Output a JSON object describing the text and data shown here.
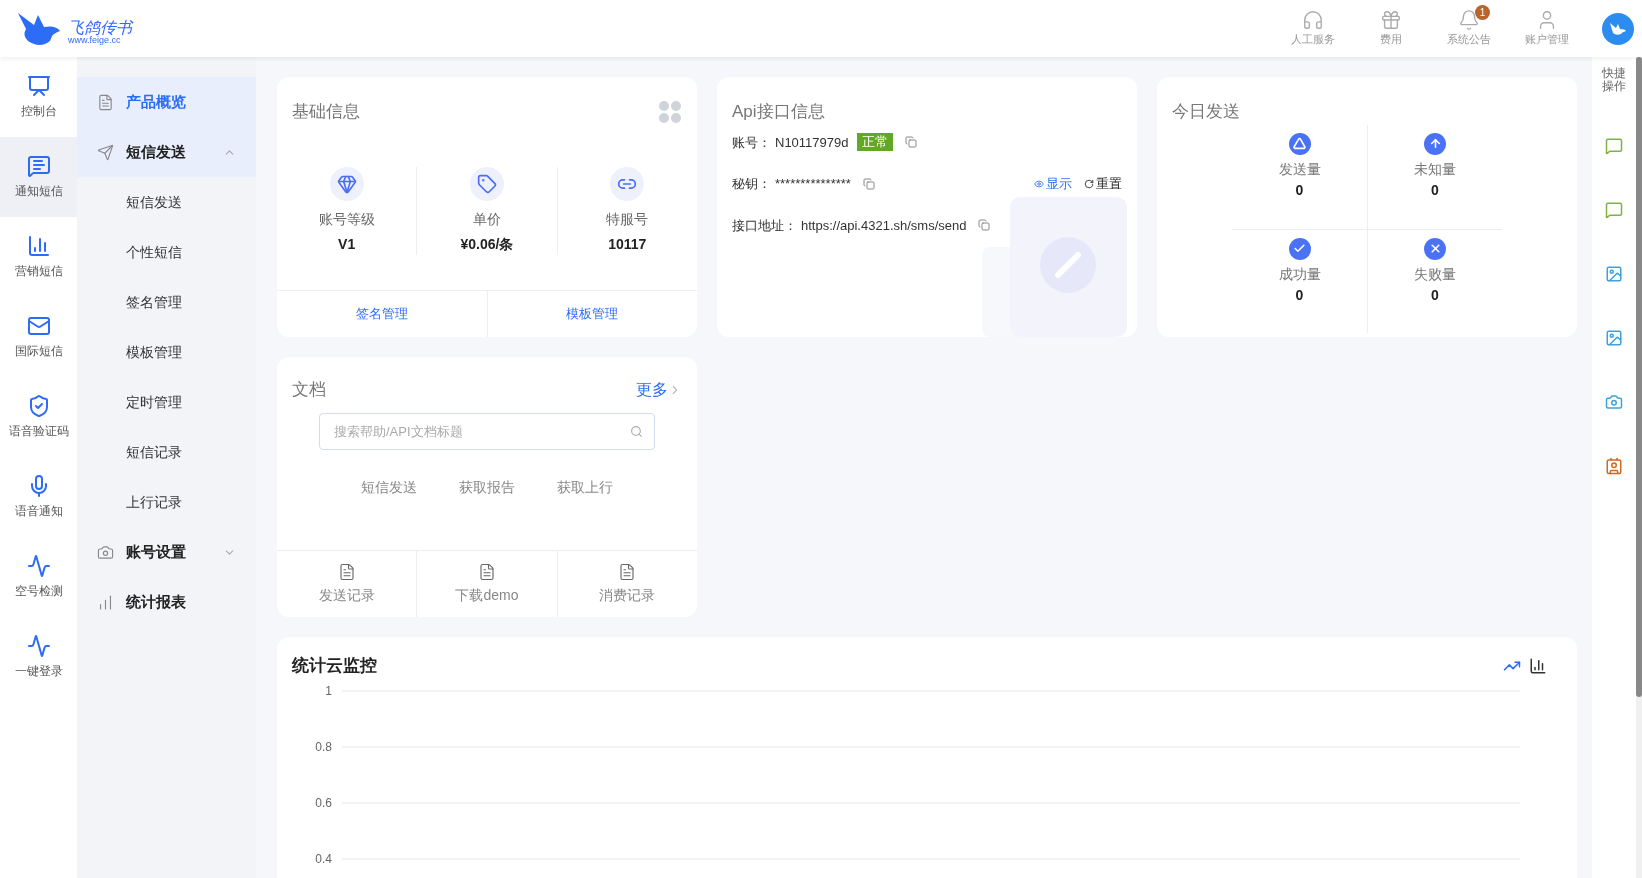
{
  "logo": {
    "name": "飞鸽传书",
    "url": "www.feige.cc"
  },
  "header_actions": [
    {
      "kind": "headset",
      "label": "人工服务"
    },
    {
      "kind": "gift",
      "label": "费用"
    },
    {
      "kind": "bell",
      "label": "系统公告",
      "badge": "1"
    },
    {
      "kind": "user",
      "label": "账户管理"
    }
  ],
  "rail": [
    {
      "kind": "monitor",
      "label": "控制台",
      "selected": false
    },
    {
      "kind": "message",
      "label": "通知短信",
      "selected": true
    },
    {
      "kind": "chart",
      "label": "营销短信",
      "selected": false
    },
    {
      "kind": "mail",
      "label": "国际短信",
      "selected": false
    },
    {
      "kind": "shield",
      "label": "语音验证码",
      "selected": false
    },
    {
      "kind": "mic",
      "label": "语音通知",
      "selected": false
    },
    {
      "kind": "activity",
      "label": "空号检测",
      "selected": false
    },
    {
      "kind": "activity",
      "label": "一键登录",
      "selected": false
    }
  ],
  "menu": [
    {
      "kind": "doc",
      "label": "产品概览",
      "selected": true
    },
    {
      "kind": "send",
      "label": "短信发送",
      "selected": false,
      "expanded": true,
      "children": [
        {
          "label": "短信发送",
          "selected": false
        },
        {
          "label": "个性短信",
          "selected": false
        },
        {
          "label": "签名管理",
          "selected": false
        },
        {
          "label": "模板管理",
          "selected": false
        },
        {
          "label": "定时管理",
          "selected": false
        },
        {
          "label": "短信记录",
          "selected": false
        },
        {
          "label": "上行记录",
          "selected": false
        }
      ]
    },
    {
      "kind": "settings",
      "label": "账号设置",
      "selected": false,
      "expanded": false
    },
    {
      "kind": "bars",
      "label": "统计报表",
      "selected": false
    }
  ],
  "basic_info": {
    "title": "基础信息",
    "stats": [
      {
        "kind": "diamond",
        "label": "账号等级",
        "value": "V1"
      },
      {
        "kind": "tag",
        "label": "单价",
        "value": "¥0.06/条"
      },
      {
        "kind": "link",
        "label": "特服号",
        "value": "10117"
      }
    ],
    "links": [
      "签名管理",
      "模板管理"
    ]
  },
  "api_info": {
    "title": "Api接口信息",
    "account_label": "账号：",
    "account": "N10117979d",
    "status": "正常",
    "secret_label": "秘钥：",
    "secret": "***************",
    "show": "显示",
    "reset": "重置",
    "url_label": "接口地址：",
    "url": "https://api.4321.sh/sms/send"
  },
  "today": {
    "title": "今日发送",
    "stats": [
      {
        "kind": "sent",
        "label": "发送量",
        "value": "0"
      },
      {
        "kind": "unknown",
        "label": "未知量",
        "value": "0"
      },
      {
        "kind": "success",
        "label": "成功量",
        "value": "0"
      },
      {
        "kind": "fail",
        "label": "失败量",
        "value": "0"
      }
    ]
  },
  "docs": {
    "title": "文档",
    "more": "更多",
    "search": {
      "placeholder": "搜索帮助/API文档标题"
    },
    "links": [
      "短信发送",
      "获取报告",
      "获取上行"
    ],
    "shortcuts": [
      "发送记录",
      "下载demo",
      "消费记录"
    ]
  },
  "monitor": {
    "title": "统计云监控",
    "views": [
      {
        "kind": "line",
        "selected": true
      },
      {
        "kind": "bar",
        "selected": false
      }
    ],
    "y_axis_labels": [
      "1",
      "0.8",
      "0.6",
      "0.4"
    ]
  },
  "quick_actions": {
    "title": "快捷操作",
    "items": [
      {
        "kind": "chat",
        "color": "#7cb342"
      },
      {
        "kind": "chat",
        "color": "#7cb342"
      },
      {
        "kind": "image",
        "color": "#3ea2d8"
      },
      {
        "kind": "image",
        "color": "#3ea2d8"
      },
      {
        "kind": "camera",
        "color": "#3ea2d8"
      },
      {
        "kind": "contact",
        "color": "#d2691e"
      }
    ]
  }
}
